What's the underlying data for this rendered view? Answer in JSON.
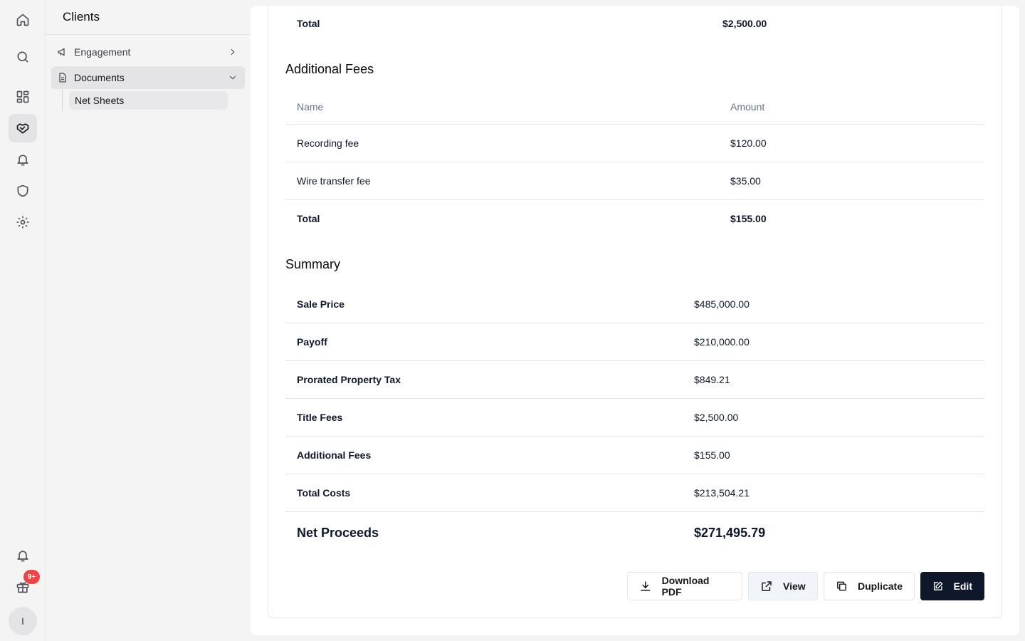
{
  "sidebar": {
    "title": "Clients",
    "items": [
      {
        "label": "Engagement"
      },
      {
        "label": "Documents"
      }
    ],
    "subitems": [
      {
        "label": "Net Sheets"
      }
    ]
  },
  "rail": {
    "badge": "9+",
    "avatar": "I"
  },
  "title_fees": {
    "total_label": "Total",
    "total_value": "$2,500.00"
  },
  "additional_fees": {
    "title": "Additional Fees",
    "columns": [
      "Name",
      "Amount"
    ],
    "rows": [
      {
        "name": "Recording fee",
        "amount": "$120.00"
      },
      {
        "name": "Wire transfer fee",
        "amount": "$35.00"
      }
    ],
    "total_label": "Total",
    "total_value": "$155.00"
  },
  "summary": {
    "title": "Summary",
    "rows": [
      {
        "label": "Sale Price",
        "value": "$485,000.00"
      },
      {
        "label": "Payoff",
        "value": "$210,000.00"
      },
      {
        "label": "Prorated Property Tax",
        "value": "$849.21"
      },
      {
        "label": "Title Fees",
        "value": "$2,500.00"
      },
      {
        "label": "Additional Fees",
        "value": "$155.00"
      },
      {
        "label": "Total Costs",
        "value": "$213,504.21"
      }
    ],
    "net_label": "Net Proceeds",
    "net_value": "$271,495.79"
  },
  "actions": {
    "download": "Download PDF",
    "view": "View",
    "duplicate": "Duplicate",
    "edit": "Edit"
  },
  "colors": {
    "primary": "#0f172a",
    "badge": "#ef4444"
  }
}
